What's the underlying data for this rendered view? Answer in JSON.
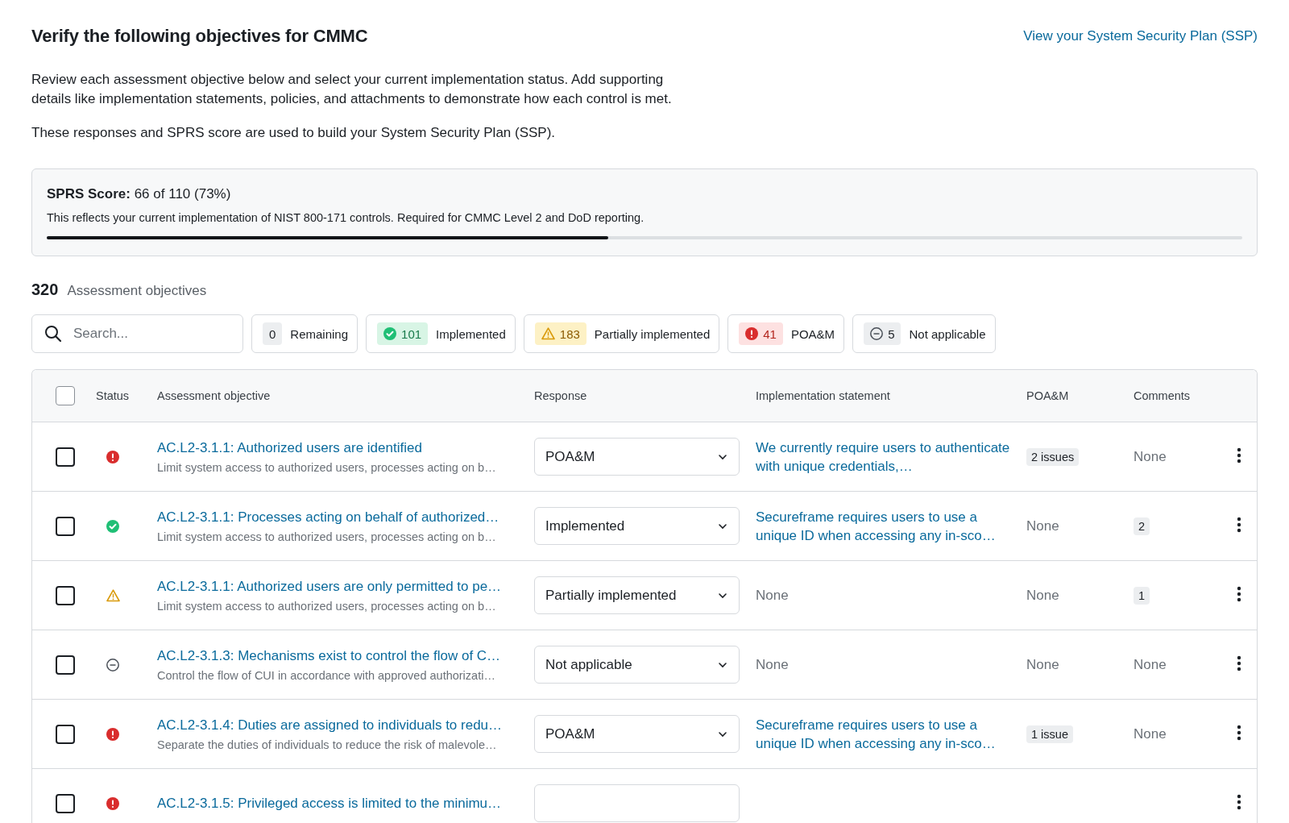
{
  "header": {
    "title": "Verify the following objectives for CMMC",
    "ssp_link": "View your System Security Plan (SSP)"
  },
  "intro": [
    "Review each assessment objective below and select your current implementation status. Add supporting details like implementation statements, policies, and attachments to demonstrate how each control is met.",
    "These responses and SPRS score are used to build your System Security Plan (SSP)."
  ],
  "score": {
    "label": "SPRS Score:",
    "value": "66 of 110 (73%)",
    "description": "This reflects your current implementation of NIST 800-171 controls. Required for CMMC Level 2 and DoD reporting.",
    "level": 0.47
  },
  "objectives": {
    "count": "320",
    "label": "Assessment objectives"
  },
  "search": {
    "placeholder": "Search..."
  },
  "filters": [
    {
      "kind": "remaining",
      "count": "0",
      "label": "Remaining"
    },
    {
      "kind": "implemented",
      "count": "101",
      "label": "Implemented"
    },
    {
      "kind": "partial",
      "count": "183",
      "label": "Partially implemented"
    },
    {
      "kind": "poam",
      "count": "41",
      "label": "POA&M"
    },
    {
      "kind": "na",
      "count": "5",
      "label": "Not applicable"
    }
  ],
  "table": {
    "select_all": {
      "checked": false
    },
    "columns": [
      "Status",
      "Assessment objective",
      "Response",
      "Implementation statement",
      "POA&M",
      "Comments"
    ],
    "rows": [
      {
        "checked": false,
        "kind": "poam",
        "title": "AC.L2-3.1.1: Authorized users are identified",
        "description": "Limit system access to authorized users, processes acting on b…",
        "response": "POA&M",
        "statement": {
          "kind": "link",
          "text": "We currently require users to authenticate with unique credentials,…"
        },
        "poam": {
          "kind": "badge",
          "text": "2 issues"
        },
        "comments": {
          "kind": "empty",
          "text": "None"
        }
      },
      {
        "checked": false,
        "kind": "implemented",
        "title": "AC.L2-3.1.1: Processes acting on behalf of authorized…",
        "description": "Limit system access to authorized users, processes acting on b…",
        "response": "Implemented",
        "statement": {
          "kind": "link",
          "text": "Secureframe requires users to use a unique ID when accessing any in-sco…"
        },
        "poam": {
          "kind": "empty",
          "text": "None"
        },
        "comments": {
          "kind": "badge",
          "text": "2"
        }
      },
      {
        "checked": false,
        "kind": "partial",
        "title": "AC.L2-3.1.1: Authorized users are only permitted to pe…",
        "description": "Limit system access to authorized users, processes acting on b…",
        "response": "Partially implemented",
        "statement": {
          "kind": "empty",
          "text": "None"
        },
        "poam": {
          "kind": "empty",
          "text": "None"
        },
        "comments": {
          "kind": "badge",
          "text": "1"
        }
      },
      {
        "checked": false,
        "kind": "na",
        "title": "AC.L2-3.1.3: Mechanisms exist to control the flow of C…",
        "description": "Control the flow of CUI in accordance with approved authorizati…",
        "response": "Not applicable",
        "statement": {
          "kind": "empty",
          "text": "None"
        },
        "poam": {
          "kind": "empty",
          "text": "None"
        },
        "comments": {
          "kind": "empty",
          "text": "None"
        }
      },
      {
        "checked": false,
        "kind": "poam",
        "title": "AC.L2-3.1.4: Duties are assigned to individuals to redu…",
        "description": "Separate the duties of individuals to reduce the risk of malevole…",
        "response": "POA&M",
        "statement": {
          "kind": "link",
          "text": "Secureframe requires users to use a unique ID when accessing any in-sco…"
        },
        "poam": {
          "kind": "badge",
          "text": "1 issue"
        },
        "comments": {
          "kind": "empty",
          "text": "None"
        }
      },
      {
        "checked": false,
        "kind": "poam",
        "title": "AC.L2-3.1.5: Privileged access is limited to the minimu…"
      }
    ]
  }
}
